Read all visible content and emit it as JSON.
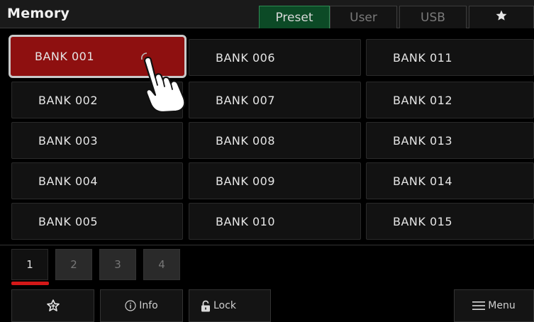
{
  "header": {
    "title": "Memory",
    "tabs": [
      {
        "label": "Preset",
        "active": true
      },
      {
        "label": "User",
        "active": false
      },
      {
        "label": "USB",
        "active": false
      },
      {
        "label": "",
        "icon": "star-icon",
        "active": false
      }
    ]
  },
  "banks": [
    {
      "label": "BANK 001",
      "selected": true
    },
    {
      "label": "BANK 002",
      "selected": false
    },
    {
      "label": "BANK 003",
      "selected": false
    },
    {
      "label": "BANK 004",
      "selected": false
    },
    {
      "label": "BANK 005",
      "selected": false
    },
    {
      "label": "BANK 006",
      "selected": false
    },
    {
      "label": "BANK 007",
      "selected": false
    },
    {
      "label": "BANK 008",
      "selected": false
    },
    {
      "label": "BANK 009",
      "selected": false
    },
    {
      "label": "BANK 010",
      "selected": false
    },
    {
      "label": "BANK 011",
      "selected": false
    },
    {
      "label": "BANK 012",
      "selected": false
    },
    {
      "label": "BANK 013",
      "selected": false
    },
    {
      "label": "BANK 014",
      "selected": false
    },
    {
      "label": "BANK 015",
      "selected": false
    }
  ],
  "pages": [
    {
      "label": "1",
      "active": true
    },
    {
      "label": "2",
      "active": false
    },
    {
      "label": "3",
      "active": false
    },
    {
      "label": "4",
      "active": false
    }
  ],
  "toolbar": {
    "favorite_icon": "star-outline-icon",
    "info_label": "Info",
    "info_icon": "info-circle-icon",
    "lock_label": "Lock",
    "lock_icon": "lock-icon",
    "menu_label": "Menu",
    "menu_icon": "hamburger-icon"
  },
  "colors": {
    "selected_bank": "#8e1010",
    "active_tab": "#0c4a26",
    "page_indicator": "#d41818"
  }
}
